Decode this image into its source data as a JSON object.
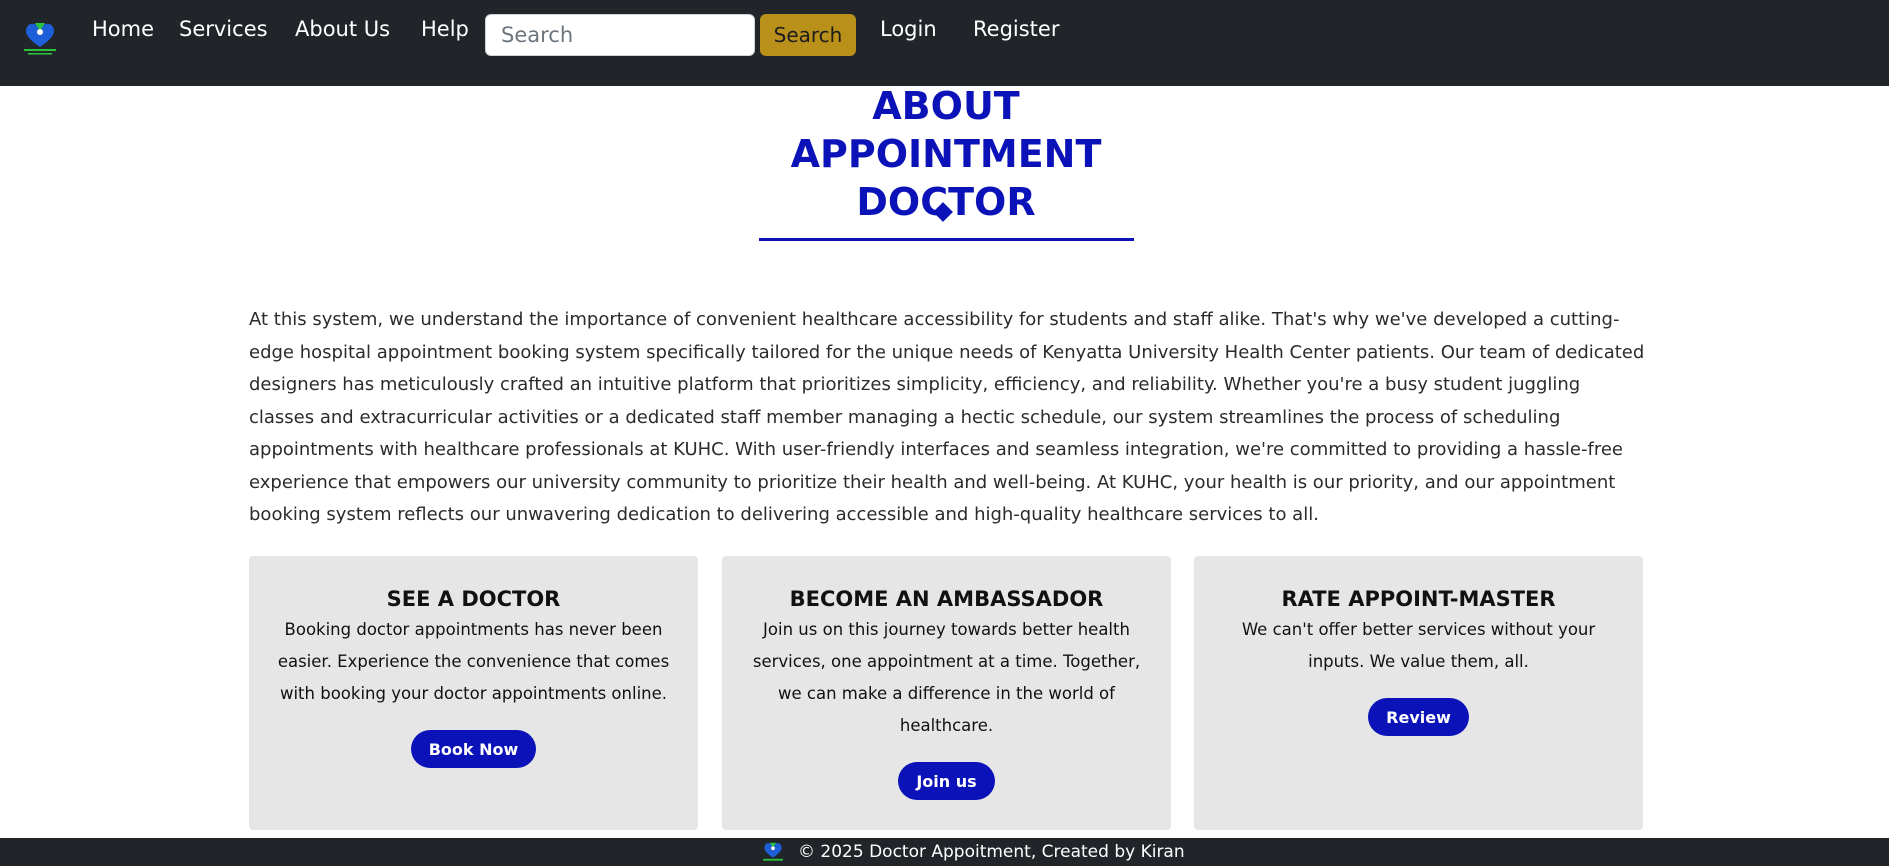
{
  "navbar": {
    "logo_icon": "doctor-heart-logo-icon",
    "links": [
      {
        "label": "Home"
      },
      {
        "label": "Services"
      },
      {
        "label": "About Us"
      },
      {
        "label": "Help"
      }
    ],
    "search": {
      "placeholder": "Search",
      "value": ""
    },
    "search_button_label": "Search",
    "login_label": "Login",
    "register_label": "Register",
    "colors": {
      "background": "#212529",
      "search_button": "#b8901a"
    }
  },
  "about": {
    "title_lines": [
      "ABOUT",
      "APPOINTMENT",
      "DOCTOR"
    ],
    "accent_color": "#0b12b8",
    "intro": "At this system, we understand the importance of convenient healthcare accessibility for students and staff alike. That's why we've developed a cutting-edge hospital appointment booking system specifically tailored for the unique needs of Kenyatta University Health Center patients. Our team of dedicated designers has meticulously crafted an intuitive platform that prioritizes simplicity, efficiency, and reliability. Whether you're a busy student juggling classes and extracurricular activities or a dedicated staff member managing a hectic schedule, our system streamlines the process of scheduling appointments with healthcare professionals at KUHC. With user-friendly interfaces and seamless integration, we're committed to providing a hassle-free experience that empowers our university community to prioritize their health and well-being. At KUHC, your health is our priority, and our appointment booking system reflects our unwavering dedication to delivering accessible and high-quality healthcare services to all."
  },
  "cards": [
    {
      "title": "SEE A DOCTOR",
      "text": "Booking doctor appointments has never been easier. Experience the convenience that comes with booking your doctor appointments online.",
      "button": "Book Now"
    },
    {
      "title": "BECOME AN AMBASSADOR",
      "text": "Join us on this journey towards better health services, one appointment at a time. Together, we can make a difference in the world of healthcare.",
      "button": "Join us"
    },
    {
      "title": "RATE APPOINT-MASTER",
      "text": "We can't offer better services without your inputs. We value them, all.",
      "button": "Review"
    }
  ],
  "footer": {
    "logo_icon": "doctor-heart-logo-icon",
    "text": "© 2025 Doctor Appoitment, Created by Kiran"
  }
}
